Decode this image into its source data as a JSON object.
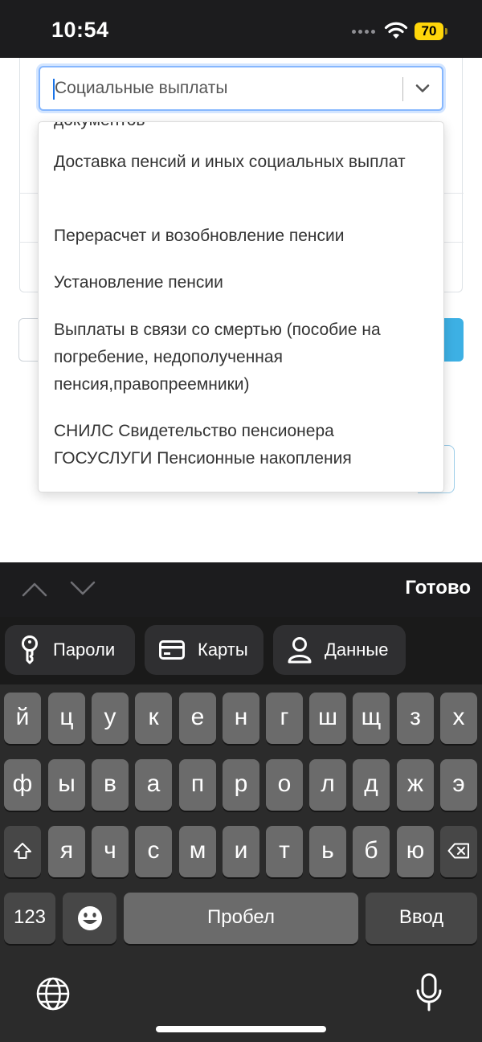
{
  "status_bar": {
    "time": "10:54",
    "battery": "70"
  },
  "select": {
    "value": "Социальные выплаты"
  },
  "dropdown": {
    "partial_option": "документов",
    "options": [
      "Доставка пенсий и иных социальных выплат",
      "Перерасчет и возобновление пенсии",
      "Установление пенсии",
      "Выплаты в связи со смертью (пособие на погребение, недополученная пенсия,правопреемники)",
      "СНИЛС Свидетельство пенсионера ГОСУСЛУГИ Пенсионные накопления"
    ]
  },
  "accessory_bar": {
    "done_label": "Готово"
  },
  "autofill": {
    "passwords": "Пароли",
    "cards": "Карты",
    "contacts": "Данные"
  },
  "keyboard": {
    "row1": [
      "й",
      "ц",
      "у",
      "к",
      "е",
      "н",
      "г",
      "ш",
      "щ",
      "з",
      "х"
    ],
    "row2": [
      "ф",
      "ы",
      "в",
      "а",
      "п",
      "р",
      "о",
      "л",
      "д",
      "ж",
      "э"
    ],
    "row3": [
      "я",
      "ч",
      "с",
      "м",
      "и",
      "т",
      "ь",
      "б",
      "ю"
    ],
    "numbers_key": "123",
    "space_key": "Пробел",
    "return_key": "Ввод"
  },
  "colors": {
    "focus_border": "#86b7fe",
    "accent_button": "#3db0e4",
    "battery": "#ffd60a"
  }
}
